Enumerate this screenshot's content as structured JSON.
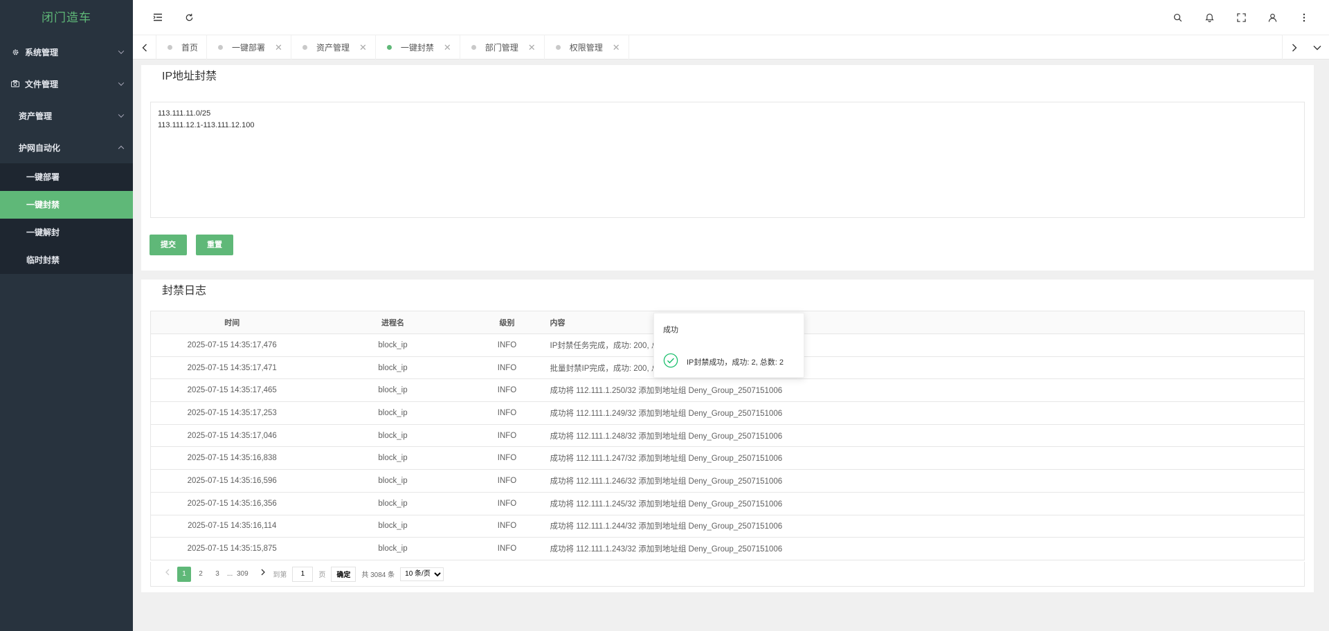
{
  "app": {
    "logo": "闭门造车"
  },
  "sidebar": {
    "items": [
      {
        "label": "系统管理",
        "icon": "gear-icon"
      },
      {
        "label": "文件管理",
        "icon": "camera-icon"
      },
      {
        "label": "资产管理"
      },
      {
        "label": "护网自动化"
      }
    ],
    "sub_items": [
      {
        "label": "一键部署"
      },
      {
        "label": "一键封禁"
      },
      {
        "label": "一键解封"
      },
      {
        "label": "临时封禁"
      }
    ]
  },
  "tabs": [
    {
      "label": "首页"
    },
    {
      "label": "一键部署"
    },
    {
      "label": "资产管理"
    },
    {
      "label": "一键封禁"
    },
    {
      "label": "部门管理"
    },
    {
      "label": "权限管理"
    }
  ],
  "ip_block": {
    "title": "IP地址封禁",
    "textarea_value": "113.111.11.0/25\n113.111.12.1-113.111.12.100",
    "submit_label": "提交",
    "reset_label": "重置"
  },
  "log": {
    "title": "封禁日志",
    "columns": [
      "时间",
      "进程名",
      "级别",
      "内容"
    ],
    "rows": [
      {
        "time": "2025-07-15 14:35:17,476",
        "proc": "block_ip",
        "level": "INFO",
        "content": "IP封禁任务完成，成功: 200, 总"
      },
      {
        "time": "2025-07-15 14:35:17,471",
        "proc": "block_ip",
        "level": "INFO",
        "content": "批量封禁IP完成，成功: 200, 总"
      },
      {
        "time": "2025-07-15 14:35:17,465",
        "proc": "block_ip",
        "level": "INFO",
        "content": "成功将 112.111.1.250/32 添加到地址组 Deny_Group_2507151006"
      },
      {
        "time": "2025-07-15 14:35:17,253",
        "proc": "block_ip",
        "level": "INFO",
        "content": "成功将 112.111.1.249/32 添加到地址组 Deny_Group_2507151006"
      },
      {
        "time": "2025-07-15 14:35:17,046",
        "proc": "block_ip",
        "level": "INFO",
        "content": "成功将 112.111.1.248/32 添加到地址组 Deny_Group_2507151006"
      },
      {
        "time": "2025-07-15 14:35:16,838",
        "proc": "block_ip",
        "level": "INFO",
        "content": "成功将 112.111.1.247/32 添加到地址组 Deny_Group_2507151006"
      },
      {
        "time": "2025-07-15 14:35:16,596",
        "proc": "block_ip",
        "level": "INFO",
        "content": "成功将 112.111.1.246/32 添加到地址组 Deny_Group_2507151006"
      },
      {
        "time": "2025-07-15 14:35:16,356",
        "proc": "block_ip",
        "level": "INFO",
        "content": "成功将 112.111.1.245/32 添加到地址组 Deny_Group_2507151006"
      },
      {
        "time": "2025-07-15 14:35:16,114",
        "proc": "block_ip",
        "level": "INFO",
        "content": "成功将 112.111.1.244/32 添加到地址组 Deny_Group_2507151006"
      },
      {
        "time": "2025-07-15 14:35:15,875",
        "proc": "block_ip",
        "level": "INFO",
        "content": "成功将 112.111.1.243/32 添加到地址组 Deny_Group_2507151006"
      }
    ]
  },
  "pager": {
    "pages": [
      "1",
      "2",
      "3"
    ],
    "ellipsis": "...",
    "last_page": "309",
    "goto_label": "到第",
    "goto_value": "1",
    "page_unit": "页",
    "confirm_label": "确定",
    "total": "共 3084 条",
    "page_size": "10 条/页"
  },
  "toast": {
    "title": "成功",
    "message": "IP封禁成功，成功: 2, 总数: 2"
  },
  "colors": {
    "accent": "#5fb878",
    "sidebar_bg": "#28333e",
    "submenu_bg": "#1e2630"
  }
}
